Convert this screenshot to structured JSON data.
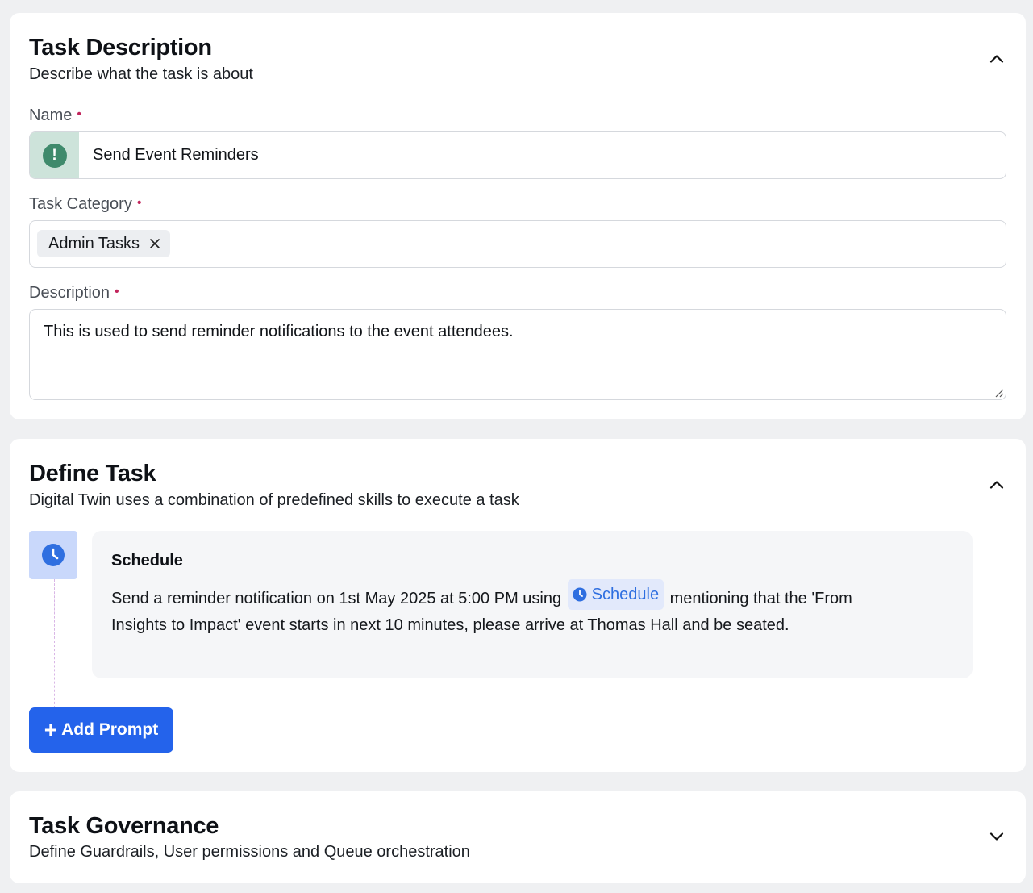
{
  "task_description": {
    "title": "Task Description",
    "subtitle": "Describe what the task is about",
    "name_label": "Name",
    "name_value": "Send Event Reminders",
    "category_label": "Task Category",
    "category_chip": "Admin Tasks",
    "description_label": "Description",
    "description_value": "This is used to send reminder notifications to the event attendees.",
    "required_marker": "•",
    "collapse_icon": "chevron-up-icon",
    "name_icon": "exclamation-icon",
    "name_icon_text": "!"
  },
  "define_task": {
    "title": "Define Task",
    "subtitle": "Digital Twin uses a combination of predefined skills to execute a task",
    "collapse_icon": "chevron-up-icon",
    "step": {
      "icon": "clock-icon",
      "title": "Schedule",
      "text_before": "Send a reminder notification on 1st May 2025 at 5:00 PM using",
      "skill_tag": "Schedule",
      "text_after": "mentioning that the 'From Insights to Impact' event starts in next 10 minutes, please arrive at Thomas Hall and be seated."
    },
    "add_button_label": "Add Prompt",
    "add_button_icon": "plus-icon"
  },
  "task_governance": {
    "title": "Task Governance",
    "subtitle": "Define Guardrails, User permissions and Queue orchestration",
    "expand_icon": "chevron-down-icon"
  },
  "colors": {
    "primary": "#2463eb",
    "required": "#c2255c",
    "success_icon": "#3f8a6c",
    "skill_tag_text": "#2f6fe0"
  }
}
